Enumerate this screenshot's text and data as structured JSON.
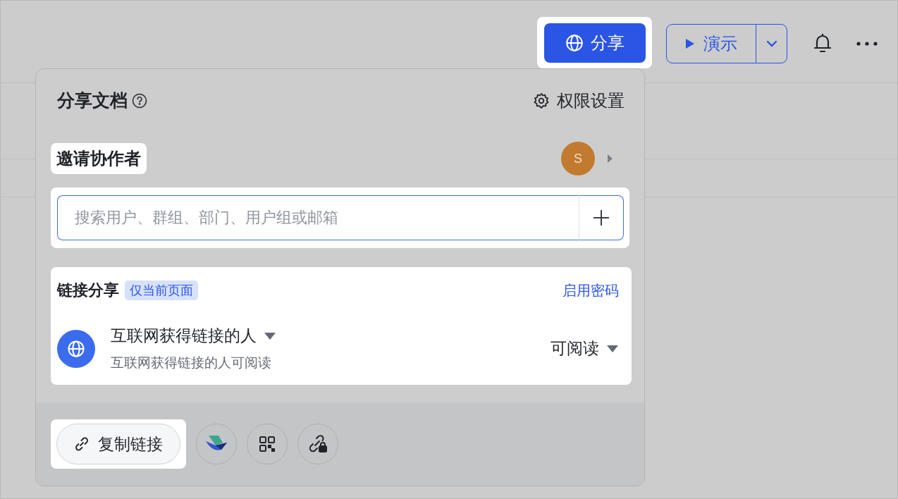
{
  "header": {
    "share_button": "分享",
    "present_button": "演示"
  },
  "share_panel": {
    "title": "分享文档",
    "permissions_label": "权限设置",
    "invite": {
      "label": "邀请协作者",
      "avatar": "S",
      "search": {
        "placeholder": "搜索用户、群组、部门、用户组或邮箱"
      }
    },
    "link_share": {
      "label": "链接分享",
      "scope_badge": "仅当前页面",
      "password_link": "启用密码",
      "audience": "互联网获得链接的人",
      "audience_note": "互联网获得链接的人可阅读",
      "permission": "可阅读"
    },
    "footer": {
      "copy_link_button": "复制链接"
    }
  }
}
